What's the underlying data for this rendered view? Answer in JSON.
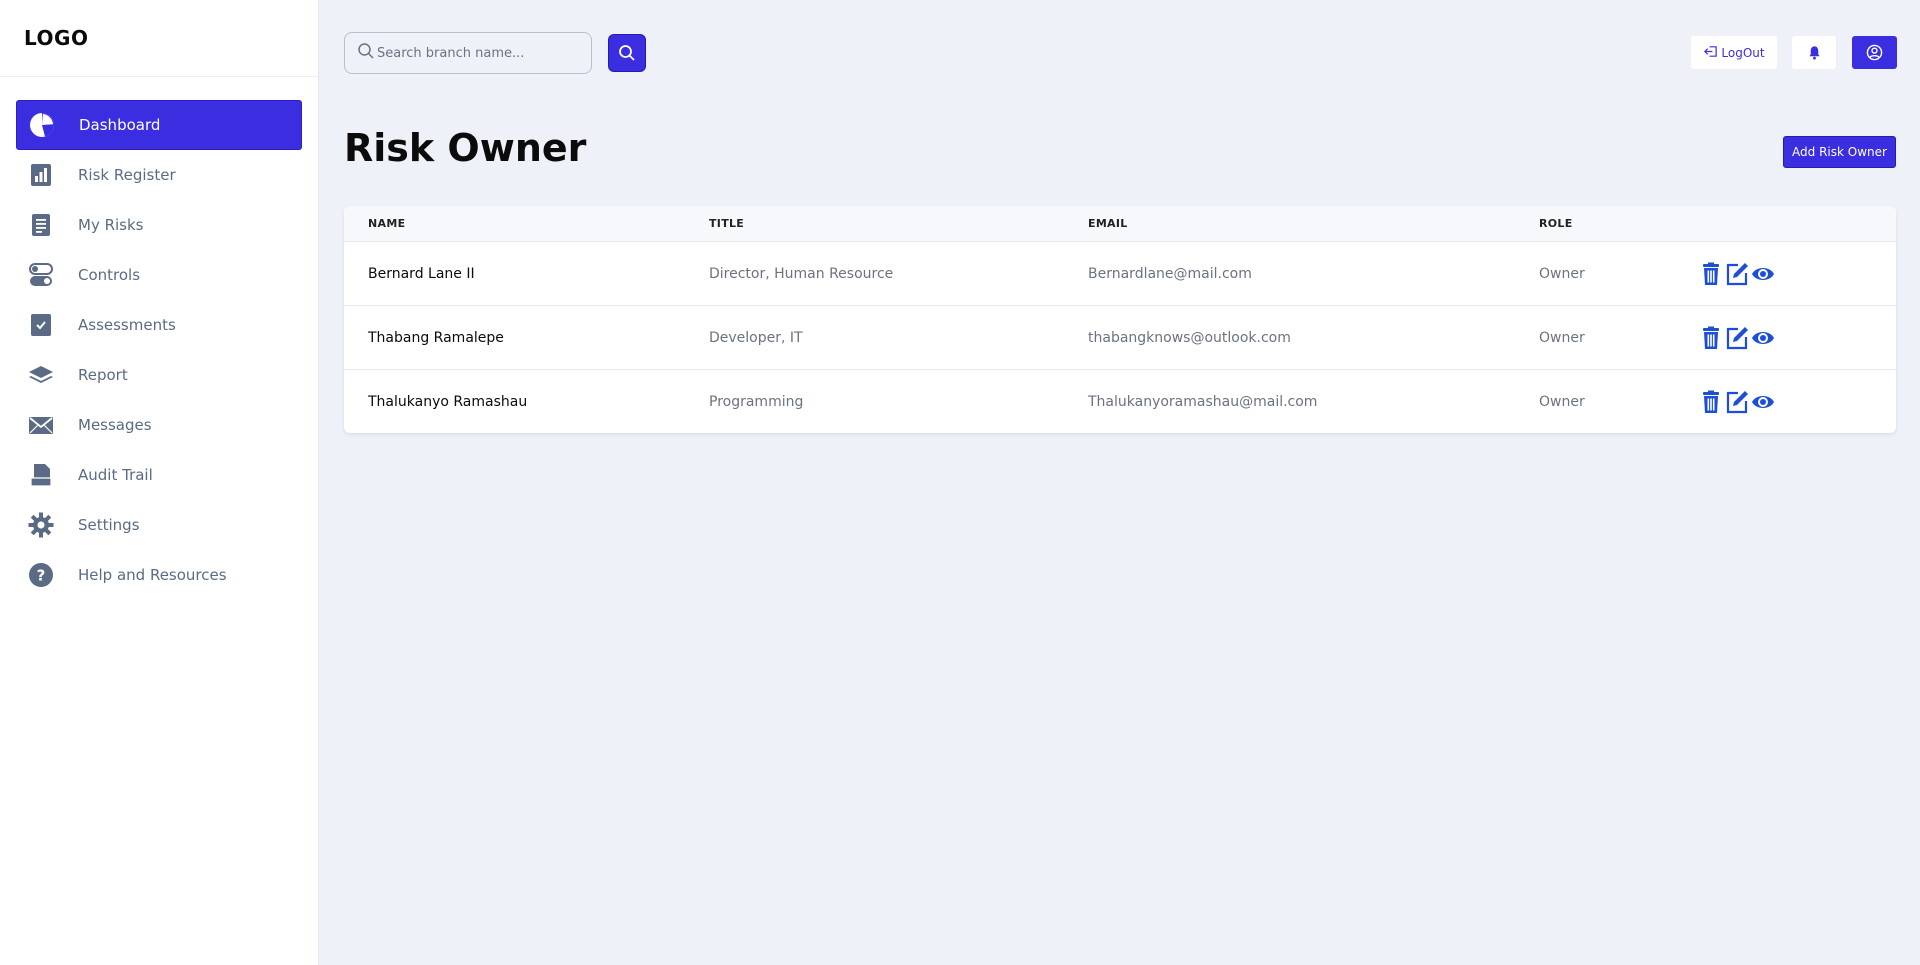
{
  "app": {
    "logo": "LOGO"
  },
  "sidebar": {
    "items": [
      {
        "label": "Dashboard",
        "icon": "pie-chart-icon",
        "active": true
      },
      {
        "label": "Risk Register",
        "icon": "bar-chart-icon",
        "active": false
      },
      {
        "label": "My Risks",
        "icon": "document-icon",
        "active": false
      },
      {
        "label": "Controls",
        "icon": "toggle-icon",
        "active": false
      },
      {
        "label": "Assessments",
        "icon": "checklist-icon",
        "active": false
      },
      {
        "label": "Report",
        "icon": "layers-icon",
        "active": false
      },
      {
        "label": "Messages",
        "icon": "envelope-icon",
        "active": false
      },
      {
        "label": "Audit Trail",
        "icon": "file-stack-icon",
        "active": false
      },
      {
        "label": "Settings",
        "icon": "gear-icon",
        "active": false
      },
      {
        "label": "Help and Resources",
        "icon": "question-icon",
        "active": false
      }
    ]
  },
  "header": {
    "search_placeholder": "Search branch name...",
    "logout_label": "LogOut"
  },
  "main": {
    "title": "Risk Owner",
    "add_button_label": "Add Risk Owner",
    "table": {
      "columns": [
        "NAME",
        "TITLE",
        "EMAIL",
        "ROLE"
      ],
      "rows": [
        {
          "name": "Bernard Lane II",
          "title": "Director, Human Resource",
          "email": "Bernardlane@mail.com",
          "role": "Owner"
        },
        {
          "name": "Thabang Ramalepe",
          "title": "Developer, IT",
          "email": "thabangknows@outlook.com",
          "role": "Owner"
        },
        {
          "name": "Thalukanyo Ramashau",
          "title": "Programming",
          "email": "Thalukanyoramashau@mail.com",
          "role": "Owner"
        }
      ]
    }
  },
  "colors": {
    "accent": "#3b2ee0",
    "sidebar_text": "#5b6b85",
    "action_icon": "#1d4ed8",
    "background": "#eff1f9"
  }
}
